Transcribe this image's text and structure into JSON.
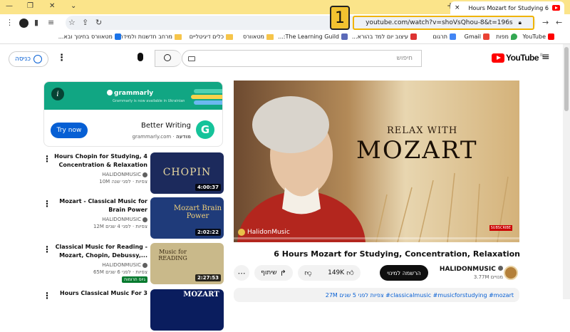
{
  "browser": {
    "tab_title": "6 Hours Mozart for Studying",
    "url": "youtube.com/watch?v=shoVsQhou-8&t=196s",
    "step_badge": "1",
    "highlight_color": "#f0b400"
  },
  "bookmarks": [
    {
      "label": "YouTube",
      "kind": "youtube"
    },
    {
      "label": "מפות",
      "kind": "maps"
    },
    {
      "label": "Gmail",
      "kind": "gmail"
    },
    {
      "label": "תרגום",
      "kind": "translate"
    },
    {
      "label": "עיצוב יום למד בהורא...",
      "kind": "site"
    },
    {
      "label": "The Learning Guild:...",
      "kind": "site"
    },
    {
      "label": "מטאוורס",
      "kind": "folder"
    },
    {
      "label": "כלים דיגיטליים",
      "kind": "folder"
    },
    {
      "label": "מרחב חדשנות ולמידה",
      "kind": "folder"
    },
    {
      "label": "מטאוורס בחינוך ובא...",
      "kind": "site"
    }
  ],
  "youtube": {
    "logo_text": "YouTube",
    "country": "IL",
    "search_placeholder": "חיפוש",
    "signin_label": "כניסה"
  },
  "video": {
    "overlay_line1": "RELAX WITH",
    "overlay_line2": "MOZART",
    "brand_watermark": "HalidonMusic",
    "subscribe_badge": "SUBSCRIBE",
    "title": "6 Hours Mozart for Studying, Concentration, Relaxation",
    "channel": "HALIDONMUSIC",
    "subscribers": "3.77M מנויים",
    "subscribe_label": "הרשמה למינוי",
    "likes": "149K",
    "share_label": "שיתוף",
    "description": "27M צפיות  לפני 5 שנים  #classicalmusic #musicforstudying #mozart"
  },
  "ad": {
    "brand": "grammarly",
    "banner_sub": "Grammarly is now available in Ukrainian",
    "cta": "Try now",
    "headline": "Better Writing",
    "domain": "grammarly.com",
    "sponsored": "מודעה"
  },
  "recommendations": [
    {
      "title": "Hours Chopin for Studying, 4 Concentration & Relaxation",
      "channel": "HALIDONMUSIC",
      "meta": "10M צפיות · לפני שנה",
      "duration": "4:00:37",
      "thumb_text": "CHOPIN",
      "thumb_bg": "#1c2a5c"
    },
    {
      "title": "Mozart - Classical Music for Brain Power",
      "channel": "HALIDONMUSIC",
      "meta": "12M צפיות · לפני 4 שנים",
      "duration": "2:02:22",
      "thumb_text": "Mozart Brain Power",
      "thumb_bg": "#1f3b7a"
    },
    {
      "title": "Classical Music for Reading - Mozart, Chopin, Debussy,...",
      "channel": "HALIDONMUSIC",
      "meta": "65M צפיות · לפני 6 שנים",
      "duration": "2:27:53",
      "thumb_text": "Music for READING",
      "thumb_bg": "#c9b98a",
      "badge": "גיוס תרומות"
    },
    {
      "title": "Hours Classical Music For 3",
      "channel": "",
      "meta": "",
      "duration": "",
      "thumb_text": "MOZART",
      "thumb_bg": "#0a1d5e"
    }
  ]
}
